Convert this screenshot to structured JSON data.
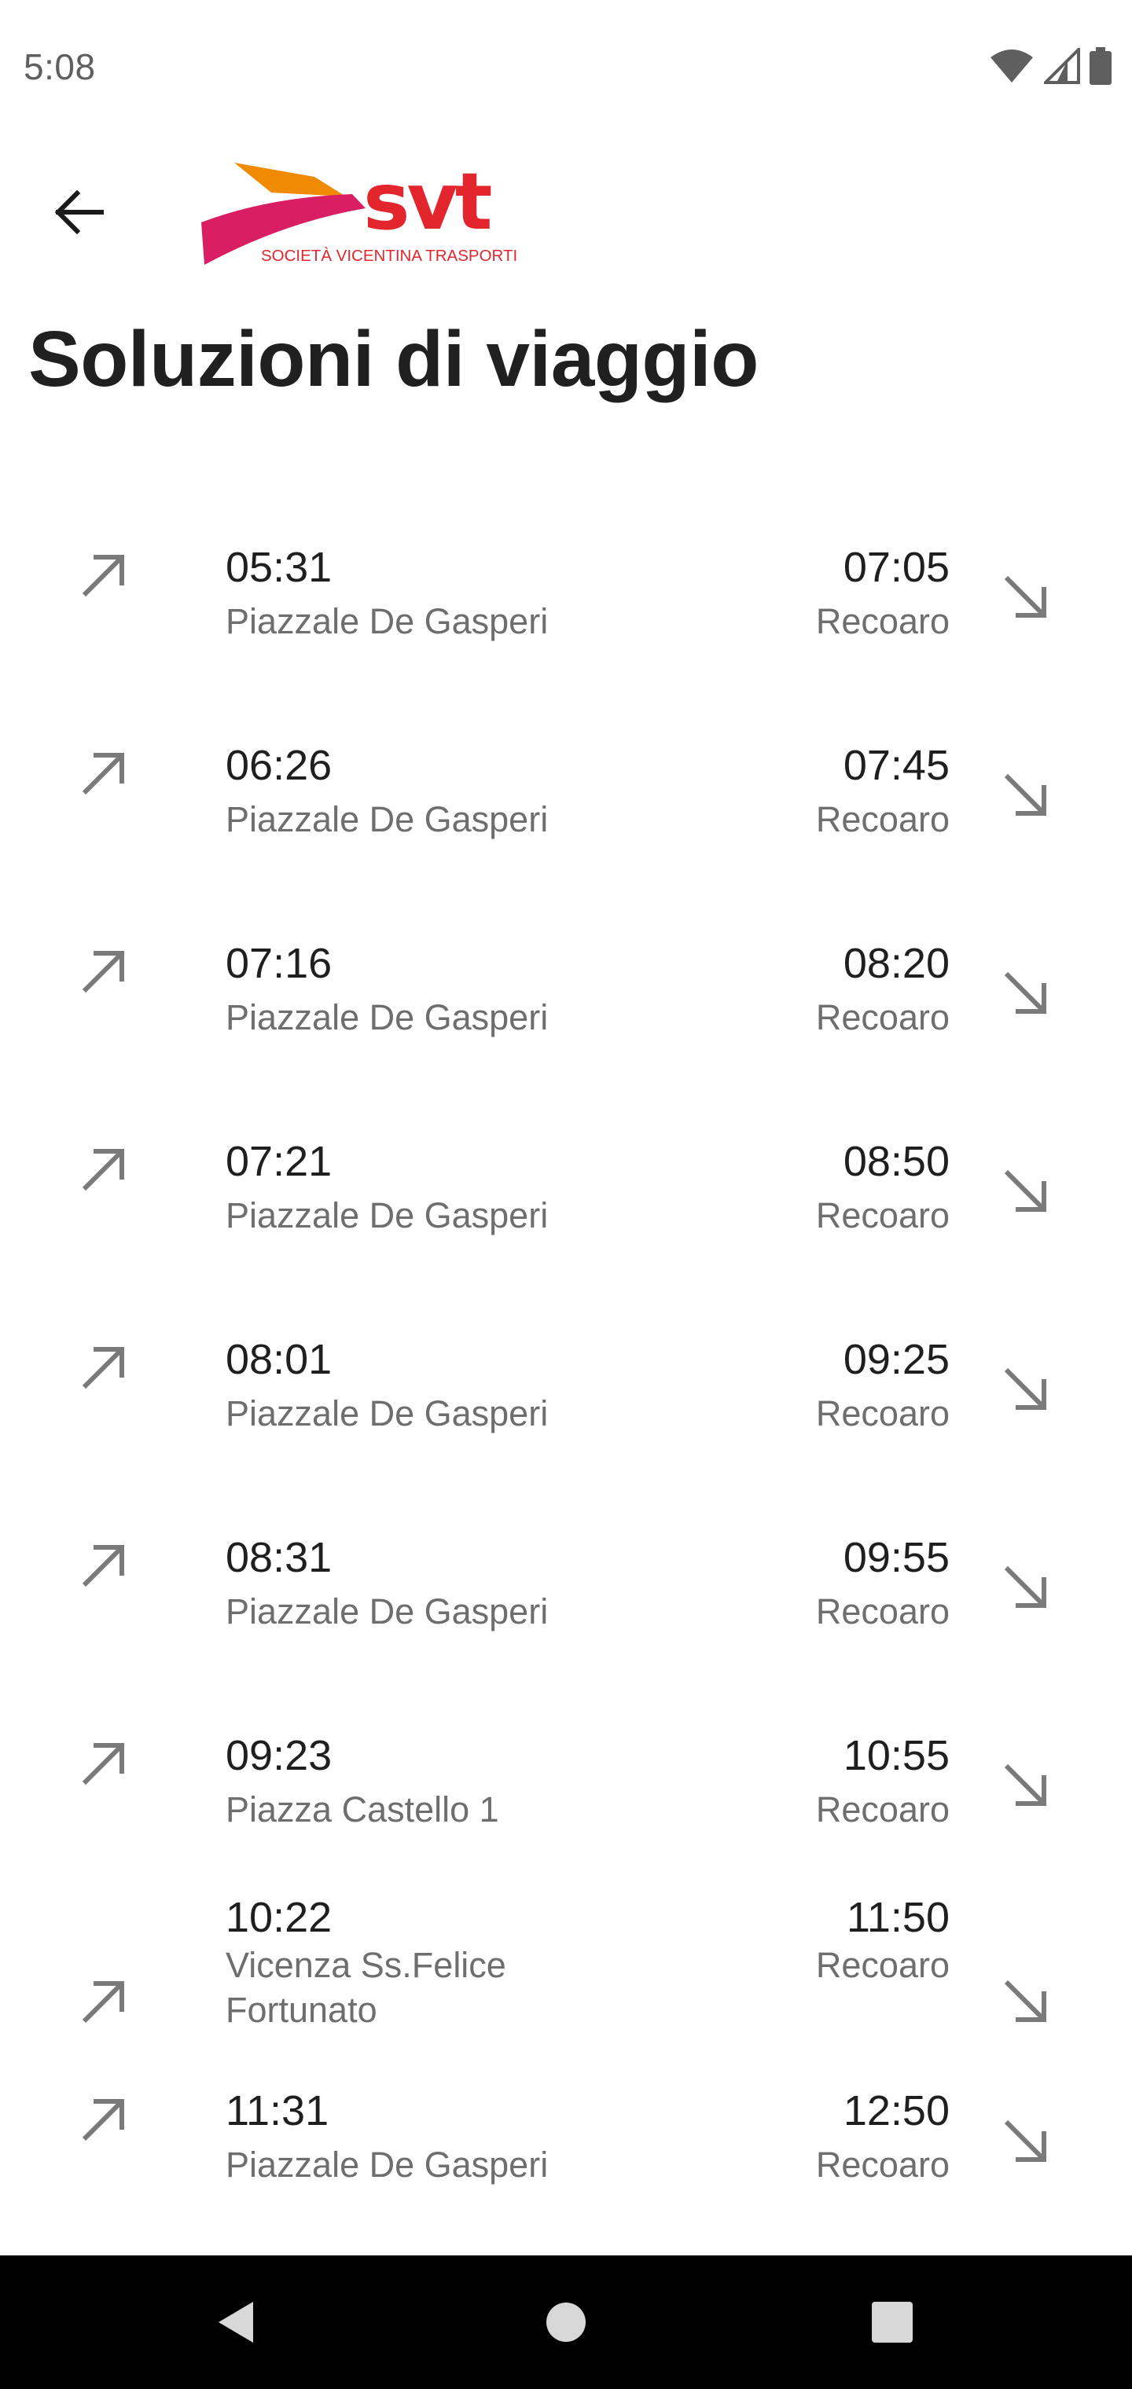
{
  "status_bar": {
    "time": "5:08",
    "icons": [
      "wifi-icon",
      "cellular-signal-icon",
      "battery-icon"
    ]
  },
  "app_bar": {
    "back_icon": "arrow-back-icon",
    "logo": {
      "wordmark": "svt",
      "tagline": "SOCIETÀ VICENTINA TRASPORTI",
      "colors": {
        "red": "#e3262d",
        "orange": "#f08a00",
        "magenta": "#d91e63"
      }
    }
  },
  "page": {
    "title": "Soluzioni di viaggio"
  },
  "journeys": [
    {
      "departure_time": "05:31",
      "departure_stop": "Piazzale De Gasperi",
      "arrival_time": "07:05",
      "arrival_stop": "Recoaro"
    },
    {
      "departure_time": "06:26",
      "departure_stop": "Piazzale De Gasperi",
      "arrival_time": "07:45",
      "arrival_stop": "Recoaro"
    },
    {
      "departure_time": "07:16",
      "departure_stop": "Piazzale De Gasperi",
      "arrival_time": "08:20",
      "arrival_stop": "Recoaro"
    },
    {
      "departure_time": "07:21",
      "departure_stop": "Piazzale De Gasperi",
      "arrival_time": "08:50",
      "arrival_stop": "Recoaro"
    },
    {
      "departure_time": "08:01",
      "departure_stop": "Piazzale De Gasperi",
      "arrival_time": "09:25",
      "arrival_stop": "Recoaro"
    },
    {
      "departure_time": "08:31",
      "departure_stop": "Piazzale De Gasperi",
      "arrival_time": "09:55",
      "arrival_stop": "Recoaro"
    },
    {
      "departure_time": "09:23",
      "departure_stop": "Piazza Castello 1",
      "arrival_time": "10:55",
      "arrival_stop": "Recoaro"
    },
    {
      "departure_time": "10:22",
      "departure_stop": "Vicenza Ss.Felice Fortunato",
      "arrival_time": "11:50",
      "arrival_stop": "Recoaro"
    },
    {
      "departure_time": "11:31",
      "departure_stop": "Piazzale De Gasperi",
      "arrival_time": "12:50",
      "arrival_stop": "Recoaro"
    }
  ],
  "icons": {
    "departure": "north-east-arrow-icon",
    "arrival": "south-east-arrow-icon",
    "color": "#7a7a7a"
  },
  "nav_bar": {
    "buttons": [
      "nav-back-icon",
      "nav-home-icon",
      "nav-recents-icon"
    ]
  }
}
